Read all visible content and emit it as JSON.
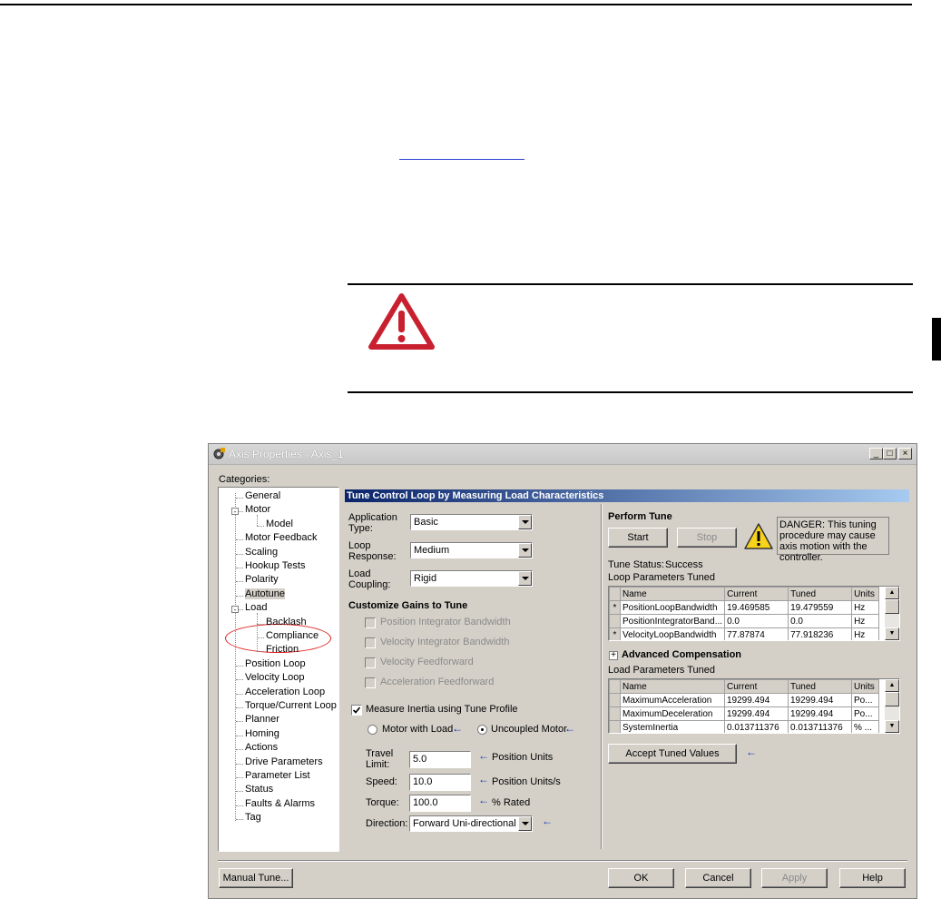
{
  "document": {
    "warning_icon": "warning-triangle-icon",
    "accent_color": "#c8202f"
  },
  "dialog": {
    "title": "Axis Properties - Axis_1",
    "window_buttons": {
      "minimize": "_",
      "maximize": "□",
      "close": "×"
    },
    "categories_label": "Categories:",
    "tree": [
      {
        "label": "General",
        "level": 0
      },
      {
        "label": "Motor",
        "level": 0,
        "expander": "-"
      },
      {
        "label": "Model",
        "level": 1
      },
      {
        "label": "Motor Feedback",
        "level": 0
      },
      {
        "label": "Scaling",
        "level": 0
      },
      {
        "label": "Hookup Tests",
        "level": 0
      },
      {
        "label": "Polarity",
        "level": 0
      },
      {
        "label": "Autotune",
        "level": 0,
        "selected": true
      },
      {
        "label": "Load",
        "level": 0,
        "expander": "-"
      },
      {
        "label": "Backlash",
        "level": 1
      },
      {
        "label": "Compliance",
        "level": 1
      },
      {
        "label": "Friction",
        "level": 1
      },
      {
        "label": "Position Loop",
        "level": 0
      },
      {
        "label": "Velocity Loop",
        "level": 0
      },
      {
        "label": "Acceleration Loop",
        "level": 0
      },
      {
        "label": "Torque/Current Loop",
        "level": 0
      },
      {
        "label": "Planner",
        "level": 0
      },
      {
        "label": "Homing",
        "level": 0
      },
      {
        "label": "Actions",
        "level": 0
      },
      {
        "label": "Drive Parameters",
        "level": 0
      },
      {
        "label": "Parameter List",
        "level": 0
      },
      {
        "label": "Status",
        "level": 0
      },
      {
        "label": "Faults & Alarms",
        "level": 0
      },
      {
        "label": "Tag",
        "level": 0
      }
    ],
    "panel_header": "Tune Control Loop by Measuring Load Characteristics",
    "application_type": {
      "label1": "Application",
      "label2": "Type:",
      "value": "Basic"
    },
    "loop_response": {
      "label1": "Loop",
      "label2": "Response:",
      "value": "Medium"
    },
    "load_coupling": {
      "label1": "Load",
      "label2": "Coupling:",
      "value": "Rigid"
    },
    "customize_heading": "Customize Gains to Tune",
    "gains": [
      "Position Integrator Bandwidth",
      "Velocity Integrator Bandwidth",
      "Velocity Feedforward",
      "Acceleration Feedforward"
    ],
    "measure_inertia": "Measure Inertia using Tune Profile",
    "motor_with_load": "Motor with Load",
    "uncoupled_motor": "Uncoupled Motor",
    "travel_limit": {
      "label1": "Travel",
      "label2": "Limit:",
      "value": "5.0",
      "unit": "Position Units"
    },
    "speed": {
      "label": "Speed:",
      "value": "10.0",
      "unit": "Position Units/s"
    },
    "torque": {
      "label": "Torque:",
      "value": "100.0",
      "unit": "% Rated"
    },
    "direction": {
      "label": "Direction:",
      "value": "Forward Uni-directional"
    },
    "perform_tune": "Perform Tune",
    "start": "Start",
    "stop": "Stop",
    "danger_text": "DANGER: This tuning procedure may cause axis motion with the controller.",
    "tune_status_label": "Tune Status:",
    "tune_status_value": "Success",
    "loop_params_label": "Loop Parameters Tuned",
    "loop_params": {
      "headers": [
        "Name",
        "Current",
        "Tuned",
        "Units"
      ],
      "rows": [
        {
          "mark": "*",
          "name": "PositionLoopBandwidth",
          "current": "19.469585",
          "tuned": "19.479559",
          "units": "Hz"
        },
        {
          "mark": "",
          "name": "PositionIntegratorBand...",
          "current": "0.0",
          "tuned": "0.0",
          "units": "Hz"
        },
        {
          "mark": "*",
          "name": "VelocityLoopBandwidth",
          "current": "77.87874",
          "tuned": "77.918236",
          "units": "Hz"
        }
      ]
    },
    "advanced_comp": "Advanced Compensation",
    "load_params_label": "Load Parameters Tuned",
    "load_params": {
      "headers": [
        "Name",
        "Current",
        "Tuned",
        "Units"
      ],
      "rows": [
        {
          "mark": "",
          "name": "MaximumAcceleration",
          "current": "19299.494",
          "tuned": "19299.494",
          "units": "Po..."
        },
        {
          "mark": "",
          "name": "MaximumDeceleration",
          "current": "19299.494",
          "tuned": "19299.494",
          "units": "Po..."
        },
        {
          "mark": "",
          "name": "SystemInertia",
          "current": "0.013711376",
          "tuned": "0.013711376",
          "units": "% ..."
        }
      ]
    },
    "accept": "Accept Tuned Values",
    "manual_tune": "Manual Tune...",
    "ok": "OK",
    "cancel": "Cancel",
    "apply": "Apply",
    "help": "Help"
  }
}
